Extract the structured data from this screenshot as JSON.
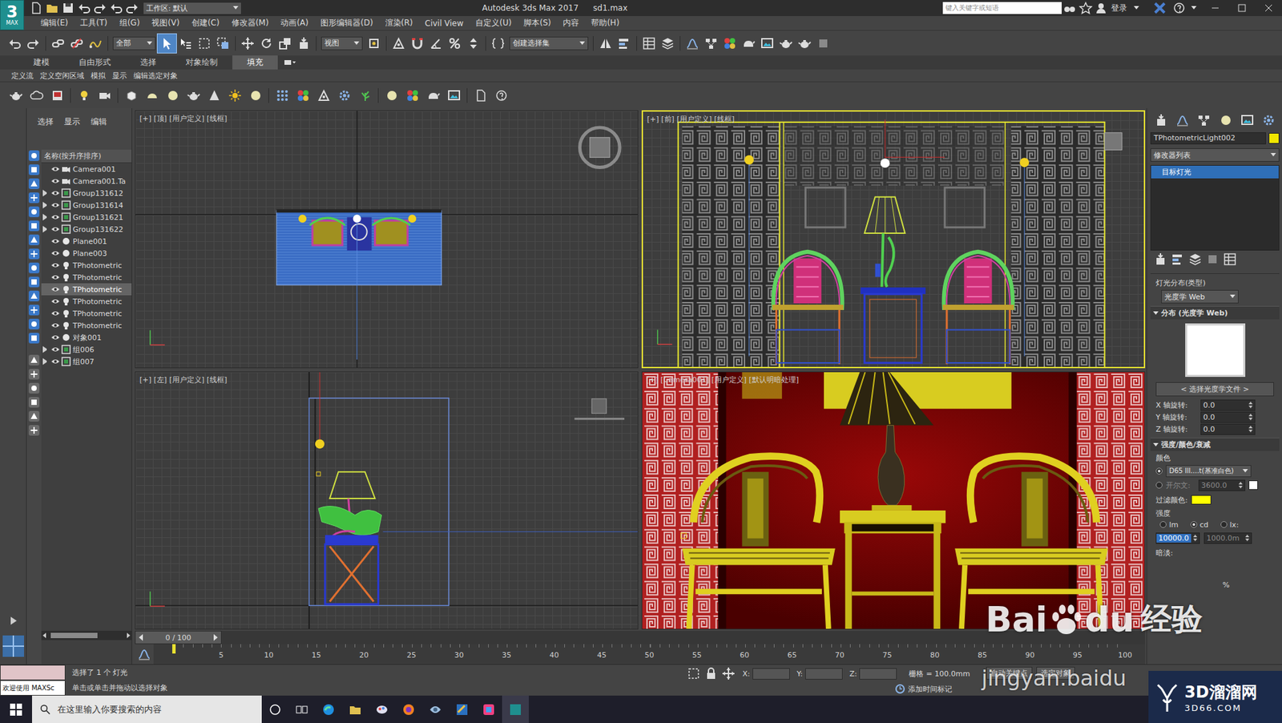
{
  "title_bar": {
    "logo": "3",
    "logo_sub": "MAX",
    "workspace": "工作区: 默认",
    "app": "Autodesk 3ds Max 2017",
    "file": "sd1.max",
    "search_placeholder": "键入关键字或短语",
    "login": "登录"
  },
  "menu": [
    "编辑(E)",
    "工具(T)",
    "组(G)",
    "视图(V)",
    "创建(C)",
    "修改器(M)",
    "动画(A)",
    "图形编辑器(D)",
    "渲染(R)",
    "Civil View",
    "自定义(U)",
    "脚本(S)",
    "内容",
    "帮助(H)"
  ],
  "main_toolbar": {
    "selection_filter": "全部",
    "ref_coord": "视图",
    "named_set": "创建选择集",
    "select_tool_active": true
  },
  "ribbon_tabs": [
    {
      "label": "建模",
      "selected": false
    },
    {
      "label": "自由形式",
      "selected": false
    },
    {
      "label": "选择",
      "selected": false
    },
    {
      "label": "对象绘制",
      "selected": false
    },
    {
      "label": "填充",
      "selected": true
    }
  ],
  "ribbon_items": [
    "定义流",
    "定义空闲区域",
    "模拟",
    "显示",
    "编辑选定对象"
  ],
  "explorer": {
    "tabs": [
      "选择",
      "显示",
      "编辑"
    ],
    "header": "名称(按升序排序)",
    "items": [
      {
        "name": "Camera001",
        "kind": "camera",
        "expandable": false,
        "selected": false
      },
      {
        "name": "Camera001.Ta",
        "kind": "camera",
        "expandable": false,
        "selected": false
      },
      {
        "name": "Group131612",
        "kind": "group",
        "expandable": true,
        "selected": false
      },
      {
        "name": "Group131614",
        "kind": "group",
        "expandable": true,
        "selected": false
      },
      {
        "name": "Group131621",
        "kind": "group",
        "expandable": true,
        "selected": false
      },
      {
        "name": "Group131622",
        "kind": "group",
        "expandable": true,
        "selected": false
      },
      {
        "name": "Plane001",
        "kind": "plane",
        "expandable": false,
        "selected": false
      },
      {
        "name": "Plane003",
        "kind": "plane",
        "expandable": false,
        "selected": false
      },
      {
        "name": "TPhotometric",
        "kind": "light",
        "expandable": false,
        "selected": false
      },
      {
        "name": "TPhotometric",
        "kind": "light",
        "expandable": false,
        "selected": false
      },
      {
        "name": "TPhotometric",
        "kind": "light",
        "expandable": false,
        "selected": true
      },
      {
        "name": "TPhotometric",
        "kind": "light",
        "expandable": false,
        "selected": false
      },
      {
        "name": "TPhotometric",
        "kind": "light",
        "expandable": false,
        "selected": false
      },
      {
        "name": "TPhotometric",
        "kind": "light",
        "expandable": false,
        "selected": false
      },
      {
        "name": "对象001",
        "kind": "plane",
        "expandable": false,
        "selected": false
      },
      {
        "name": "组006",
        "kind": "group",
        "expandable": true,
        "selected": false
      },
      {
        "name": "组007",
        "kind": "group",
        "expandable": true,
        "selected": false
      }
    ]
  },
  "viewports": [
    {
      "label": "[+] [顶] [用户定义] [线框]",
      "kind": "top",
      "active": false
    },
    {
      "label": "[+] [前] [用户定义] [线框]",
      "kind": "front",
      "active": true
    },
    {
      "label": "[+] [左] [用户定义] [线框]",
      "kind": "left",
      "active": false
    },
    {
      "label": "[+] [Camera001] [用户定义] [默认明暗处理]",
      "kind": "camera",
      "active": false
    }
  ],
  "command_panel": {
    "object_name": "TPhotometricLight002",
    "object_color": "#f2e600",
    "modifier_list": "修改器列表",
    "stack": [
      {
        "label": "目标灯光",
        "selected": true
      }
    ],
    "distribution_label": "灯光分布(类型)",
    "distribution_value": "光度学 Web",
    "web_rollout": "分布 (光度学 Web)",
    "select_file": "< 选择光度学文件 >",
    "rotations": [
      {
        "label": "X 轴旋转:",
        "value": "0.0"
      },
      {
        "label": "Y 轴旋转:",
        "value": "0.0"
      },
      {
        "label": "Z 轴旋转:",
        "value": "0.0"
      }
    ],
    "intensity_rollout": "强度/颜色/衰减",
    "color_label": "颜色",
    "color_options": [
      {
        "kind": "preset",
        "label": "D65 Ill....t(基准白色)",
        "selected": true,
        "disabled": false
      },
      {
        "kind": "kelvin",
        "label": "开尔文:",
        "value": "3600.0",
        "swatch": "#ffffff",
        "selected": false,
        "disabled": true
      }
    ],
    "filter_label": "过滤颜色:",
    "filter_color": "#ffff00",
    "intensity_label": "强度",
    "units": [
      {
        "label": "lm",
        "selected": false
      },
      {
        "label": "cd",
        "selected": true
      },
      {
        "label": "lx:",
        "selected": false
      }
    ],
    "intensity_value": "10000.0",
    "distance_value": "1000.0m",
    "dimming_label": "暗淡:",
    "percent": "%"
  },
  "timeline": {
    "frame": "0 / 100",
    "level": 0,
    "ticks": [
      "5",
      "10",
      "15",
      "20",
      "25",
      "30",
      "35",
      "40",
      "45",
      "50",
      "55",
      "60",
      "65",
      "70",
      "75",
      "80",
      "85",
      "90",
      "95",
      "100"
    ]
  },
  "status_bar": {
    "listener": "欢迎使用 MAXSc",
    "prompt": "选择了 1 个 灯光",
    "hint": "单击或单击并拖动以选择对象",
    "x_label": "X:",
    "y_label": "Y:",
    "z_label": "Z:",
    "grid": "栅格 = 100.0mm",
    "add_tag": "添加时间标记",
    "auto_key": "自动关键点",
    "selected": "选定对象"
  },
  "taskbar": {
    "search": "在这里输入你要搜索的内容"
  },
  "watermarks": {
    "baidu_a": "Bai",
    "baidu_b": "du",
    "baidu_c": "经验",
    "baidu_url": "jingyan.baidu",
    "site_name": "3D溜溜网",
    "site_url": "3D66.COM"
  }
}
